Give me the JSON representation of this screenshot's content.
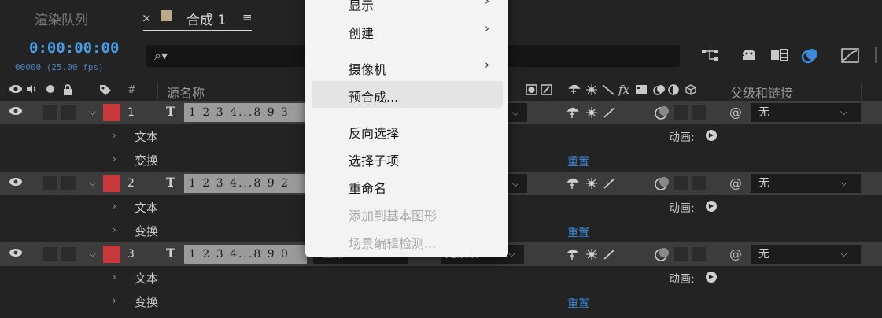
{
  "tabs": {
    "render_queue": "渲染队列",
    "close": "×",
    "comp_name": "合成 1",
    "menu": "≡"
  },
  "time": {
    "timecode": "0:00:00:00",
    "fps": "00000 (25.00 fps)"
  },
  "search": {
    "icon": "⌕▾",
    "placeholder": ""
  },
  "header": {
    "source_name": "源名称",
    "hash": "#",
    "parent": "父级和链接"
  },
  "layers": [
    {
      "num": "1",
      "name": "1 2 3 4...8 9 3",
      "parent": "无"
    },
    {
      "num": "2",
      "name": "1 2 3 4...8 9 2",
      "parent": "无"
    },
    {
      "num": "3",
      "name": "1 2 3 4...8 9 0",
      "parent": "无"
    }
  ],
  "sub": {
    "text": "文本",
    "transform": "变换",
    "animate": "动画:",
    "reset": "重置"
  },
  "menu": {
    "items": [
      {
        "label": "显示",
        "arrow": "›"
      },
      {
        "label": "创建",
        "arrow": "›"
      },
      {
        "label": "摄像机",
        "arrow": "›"
      },
      {
        "label": "预合成..."
      },
      {
        "label": "反向选择"
      },
      {
        "label": "选择子项"
      },
      {
        "label": "重命名"
      },
      {
        "label": "添加到基本图形"
      },
      {
        "label": "场景编辑检测..."
      }
    ]
  },
  "layer3_mode": "正常",
  "layer3_matte": "无蒙版",
  "t_glyph": "T"
}
